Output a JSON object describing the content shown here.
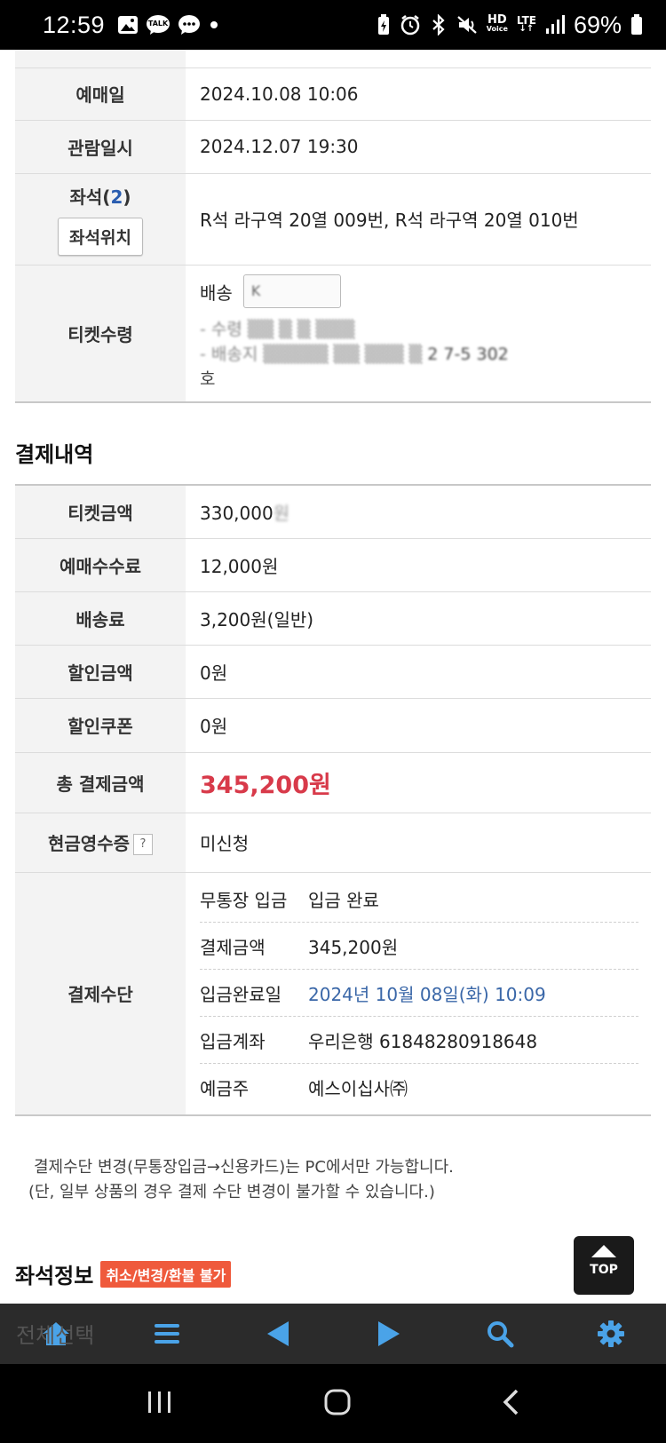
{
  "status_bar": {
    "time": "12:59",
    "talk_label": "TALK",
    "hd_label": "HD",
    "voice_label": "Voice",
    "lte_label": "LTE",
    "battery": "69%"
  },
  "booking_table": [
    {
      "label": "예매일",
      "value": "2024.10.08 10:06"
    },
    {
      "label": "관람일시",
      "value": "2024.12.07 19:30"
    }
  ],
  "seat": {
    "label": "좌석",
    "count": "2",
    "location_button": "좌석위치",
    "value": "R석 라구역 20열 009번, R석 라구역 20열 010번"
  },
  "ticket_receipt": {
    "label": "티켓수령",
    "method_label": "배송",
    "method_value": "K",
    "line1": "- 수령",
    "line2": "- 배송지",
    "line2_tail": "2   7-5 302",
    "line3": "호"
  },
  "payment_title": "결제내역",
  "payment_table": [
    {
      "label": "티켓금액",
      "value": "330,000"
    },
    {
      "label": "예매수수료",
      "value": "12,000원"
    },
    {
      "label": "배송료",
      "value": "3,200원(일반)"
    },
    {
      "label": "할인금액",
      "value": "0원"
    },
    {
      "label": "할인쿠폰",
      "value": "0원"
    }
  ],
  "total": {
    "label": "총 결제금액",
    "value": "345,200원"
  },
  "cash_receipt": {
    "label": "현금영수증",
    "help": "?",
    "value": "미신청"
  },
  "payment_method": {
    "label": "결제수단",
    "rows": [
      {
        "key": "무통장 입금",
        "value": "입금 완료"
      },
      {
        "key": "결제금액",
        "value": "345,200원"
      },
      {
        "key": "입금완료일",
        "value": "2024년 10월 08일(화) 10:09"
      },
      {
        "key": "입금계좌",
        "value": "우리은행 61848280918648"
      },
      {
        "key": "예금주",
        "value": "예스이십사㈜"
      }
    ]
  },
  "notice": {
    "line1": "결제수단 변경(무통장입금→신용카드)는 PC에서만 가능합니다.",
    "line2": "(단, 일부 상품의 경우 결제 수단 변경이 불가할 수 있습니다.)"
  },
  "seat_info": {
    "title": "좌석정보",
    "badge": "취소/변경/환불 불가"
  },
  "partial_text": "전체선택",
  "top_button": "TOP",
  "colors": {
    "total_red": "#d83a4a",
    "date_blue": "#3a67a8",
    "badge_orange": "#ef5a3c"
  }
}
